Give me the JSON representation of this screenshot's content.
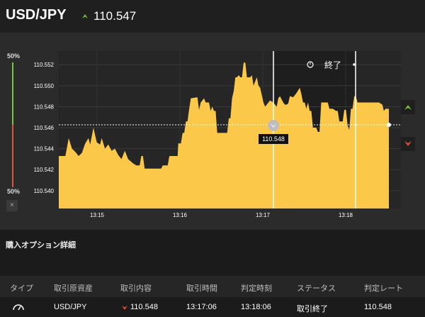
{
  "header": {
    "pair": "USD/JPY",
    "price": "110.547",
    "direction_icon": "up-arrow-icon",
    "up_color": "#7cc63c"
  },
  "sidebar": {
    "top_pct": "50%",
    "bottom_pct": "50%",
    "close_label": "×",
    "up_color": "#7cc63c",
    "down_color": "#e0533e"
  },
  "chart": {
    "end_label": "終了",
    "clock_icon": "history-icon",
    "marker_label": "110.548",
    "area_color": "#fbc849"
  },
  "chart_data": {
    "type": "area",
    "x_ticks": [
      "13:15",
      "13:16",
      "13:17",
      "13:18"
    ],
    "y_ticks": [
      "110.552",
      "110.550",
      "110.548",
      "110.546",
      "110.544",
      "110.542",
      "110.540"
    ],
    "ylim": [
      110.5383,
      110.5533
    ],
    "current_price": 110.547,
    "entry_time_label": "13:17",
    "entry_price": 110.548,
    "series": [
      {
        "values": [
          [
            0,
            110.5433
          ],
          [
            0.02,
            110.5433
          ],
          [
            0.03,
            110.545
          ],
          [
            0.04,
            110.544
          ],
          [
            0.05,
            110.5437
          ],
          [
            0.06,
            110.5433
          ],
          [
            0.07,
            110.5436
          ],
          [
            0.08,
            110.5445
          ],
          [
            0.09,
            110.545
          ],
          [
            0.095,
            110.5444
          ],
          [
            0.105,
            110.546
          ],
          [
            0.115,
            110.5446
          ],
          [
            0.125,
            110.5444
          ],
          [
            0.13,
            110.545
          ],
          [
            0.14,
            110.544
          ],
          [
            0.15,
            110.5444
          ],
          [
            0.16,
            110.5438
          ],
          [
            0.17,
            110.544
          ],
          [
            0.18,
            110.5434
          ],
          [
            0.19,
            110.543
          ],
          [
            0.2,
            110.5438
          ],
          [
            0.21,
            110.543
          ],
          [
            0.225,
            110.5426
          ],
          [
            0.235,
            110.5424
          ],
          [
            0.245,
            110.5424
          ],
          [
            0.25,
            110.5433
          ],
          [
            0.255,
            110.5433
          ],
          [
            0.26,
            110.5421
          ],
          [
            0.28,
            110.5421
          ],
          [
            0.3,
            110.5421
          ],
          [
            0.31,
            110.5421
          ],
          [
            0.315,
            110.5424
          ],
          [
            0.33,
            110.5424
          ],
          [
            0.335,
            110.5433
          ],
          [
            0.36,
            110.5433
          ],
          [
            0.362,
            110.5445
          ],
          [
            0.37,
            110.5445
          ],
          [
            0.375,
            110.5455
          ],
          [
            0.38,
            110.5455
          ],
          [
            0.385,
            110.5466
          ],
          [
            0.39,
            110.5466
          ],
          [
            0.395,
            110.5478
          ],
          [
            0.4,
            110.5488
          ],
          [
            0.42,
            110.5489
          ],
          [
            0.425,
            110.5477
          ],
          [
            0.43,
            110.5484
          ],
          [
            0.44,
            110.5488
          ],
          [
            0.445,
            110.5484
          ],
          [
            0.455,
            110.5484
          ],
          [
            0.46,
            110.5476
          ],
          [
            0.465,
            110.548
          ],
          [
            0.47,
            110.5476
          ],
          [
            0.475,
            110.5476
          ],
          [
            0.48,
            110.5455
          ],
          [
            0.49,
            110.5455
          ],
          [
            0.5,
            110.5455
          ],
          [
            0.51,
            110.5455
          ],
          [
            0.515,
            110.5469
          ],
          [
            0.52,
            110.5469
          ],
          [
            0.525,
            110.5488
          ],
          [
            0.53,
            110.5495
          ],
          [
            0.535,
            110.5508
          ],
          [
            0.54,
            110.5508
          ],
          [
            0.545,
            110.551
          ],
          [
            0.55,
            110.5508
          ],
          [
            0.555,
            110.5508
          ],
          [
            0.56,
            110.5522
          ],
          [
            0.565,
            110.5522
          ],
          [
            0.57,
            110.5508
          ],
          [
            0.58,
            110.5508
          ],
          [
            0.585,
            110.551
          ],
          [
            0.59,
            110.55
          ],
          [
            0.6,
            110.5508
          ],
          [
            0.605,
            110.55
          ],
          [
            0.61,
            110.5498
          ],
          [
            0.62,
            110.5484
          ],
          [
            0.625,
            110.548
          ],
          [
            0.63,
            110.5482
          ],
          [
            0.64,
            110.5486
          ],
          [
            0.65,
            110.5484
          ],
          [
            0.66,
            110.548
          ],
          [
            0.665,
            110.5488
          ],
          [
            0.67,
            110.549
          ],
          [
            0.68,
            110.5484
          ],
          [
            0.685,
            110.5482
          ],
          [
            0.69,
            110.5482
          ],
          [
            0.695,
            110.5483
          ],
          [
            0.7,
            110.549
          ],
          [
            0.71,
            110.5489
          ],
          [
            0.72,
            110.5493
          ],
          [
            0.73,
            110.5498
          ],
          [
            0.735,
            110.5492
          ],
          [
            0.74,
            110.5484
          ],
          [
            0.745,
            110.5484
          ],
          [
            0.75,
            110.5478
          ],
          [
            0.755,
            110.5484
          ],
          [
            0.76,
            110.5476
          ],
          [
            0.765,
            110.5476
          ],
          [
            0.77,
            110.546
          ],
          [
            0.78,
            110.546
          ],
          [
            0.785,
            110.5456
          ],
          [
            0.79,
            110.5456
          ],
          [
            0.795,
            110.5484
          ],
          [
            0.81,
            110.5484
          ],
          [
            0.815,
            110.5484
          ],
          [
            0.82,
            110.5478
          ],
          [
            0.83,
            110.5478
          ],
          [
            0.84,
            110.5476
          ],
          [
            0.845,
            110.5476
          ],
          [
            0.85,
            110.5466
          ],
          [
            0.86,
            110.5466
          ],
          [
            0.865,
            110.5477
          ],
          [
            0.87,
            110.5477
          ],
          [
            0.875,
            110.5462
          ],
          [
            0.88,
            110.5458
          ],
          [
            0.885,
            110.5478
          ],
          [
            0.89,
            110.5478
          ],
          [
            0.895,
            110.549
          ],
          [
            0.9,
            110.549
          ],
          [
            0.905,
            110.5484
          ],
          [
            0.91,
            110.5484
          ],
          [
            0.95,
            110.5484
          ],
          [
            0.97,
            110.5484
          ],
          [
            0.98,
            110.5482
          ],
          [
            0.985,
            110.5476
          ],
          [
            0.99,
            110.5478
          ],
          [
            1.0,
            110.5478
          ]
        ]
      }
    ]
  },
  "details": {
    "title": "購入オプション詳細",
    "columns": [
      "タイプ",
      "取引原資産",
      "取引内容",
      "取引時間",
      "判定時刻",
      "ステータス",
      "判定レート"
    ],
    "row": {
      "type_icon": "gauge-icon",
      "asset": "USD/JPY",
      "direction_icon": "down-arrow-icon",
      "content": "110.548",
      "trade_time": "13:17:06",
      "judge_time": "13:18:06",
      "status": "取引終了",
      "rate": "110.548"
    }
  }
}
